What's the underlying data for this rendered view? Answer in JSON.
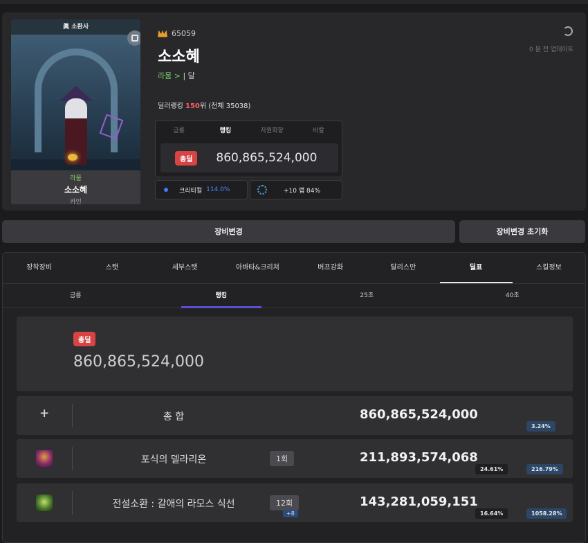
{
  "profile": {
    "portrait_title": "眞 소환사",
    "portrait_server": "라뭄",
    "portrait_name": "소소혜",
    "portrait_class": "카인",
    "fame": "65059",
    "name": "소소혜",
    "server_line_server": "라뭄 >",
    "server_line_rest": " | 달",
    "updated": "0 분 전 업데이트",
    "rank_prefix": "딜러랭킹 ",
    "rank_value": "150",
    "rank_suffix": "위 (전체 35038)"
  },
  "rankbox": {
    "tabs": [
      "금룡",
      "랭킹",
      "자원회향",
      "바칼"
    ],
    "active_tab": "랭킹",
    "badge": "총딜",
    "value": "860,865,524,000"
  },
  "chips": {
    "crit_label": "크리티컬",
    "crit_pct": "114.0%",
    "rune_label": "+10 랩 84%"
  },
  "buttons": {
    "change_equip": "장비변경",
    "reset_equip": "장비변경 초기화"
  },
  "main_tabs": [
    "장착장비",
    "스탯",
    "세부스탯",
    "아바타&크리쳐",
    "버프강화",
    "탈리스만",
    "딜표",
    "스킬정보"
  ],
  "sub_tabs": [
    "금룡",
    "랭킹",
    "25초",
    "40초"
  ],
  "total": {
    "badge": "총딜",
    "value": "860,865,524,000"
  },
  "rows": [
    {
      "name": "총 합",
      "damage": "860,865,524,000",
      "blue_pct": "3.24%"
    },
    {
      "name": "포식의 델라리온",
      "count": "1회",
      "damage": "211,893,574,068",
      "dark_pct": "24.61%",
      "blue_pct": "216.79%"
    },
    {
      "name": "전설소환 : 갈애의 라모스 식선",
      "count": "12회",
      "plus": "+8",
      "damage": "143,281,059,151",
      "dark_pct": "16.64%",
      "blue_pct": "1058.28%"
    }
  ],
  "colors": {
    "accent_red": "#d84343",
    "accent_purple": "#5a4fd0",
    "crit_blue": "#4b8bff",
    "server_green": "#7cc96a"
  }
}
